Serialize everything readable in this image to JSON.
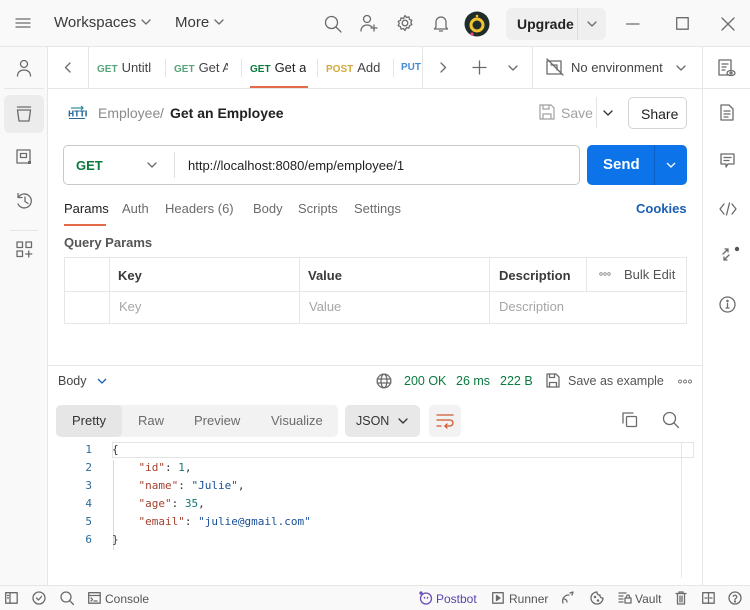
{
  "titlebar": {
    "workspaces_label": "Workspaces",
    "more_label": "More",
    "upgrade_label": "Upgrade",
    "avatar_colors": {
      "bg": "#1f2d2a",
      "ring": "#f2c230",
      "dot": "#e0457b"
    }
  },
  "tabs": [
    {
      "method": "GET",
      "title": "Untitle",
      "method_color": "#58a57a",
      "active": false
    },
    {
      "method": "GET",
      "title": "Get A",
      "method_color": "#58a57a",
      "active": false
    },
    {
      "method": "GET",
      "title": "Get ar",
      "method_color": "#0b7a3e",
      "active": true
    },
    {
      "method": "POST",
      "title": "Add",
      "method_color": "#d4a93a",
      "active": false
    },
    {
      "method": "PUT",
      "title": "",
      "method_color": "#4a8ad4",
      "active": false
    }
  ],
  "environment": {
    "label": "No environment"
  },
  "breadcrumb": {
    "collection": "Employee",
    "separator": "/",
    "request": "Get an Employee"
  },
  "actions": {
    "save_label": "Save",
    "share_label": "Share"
  },
  "request": {
    "method": "GET",
    "url": "http://localhost:8080/emp/employee/1",
    "send_label": "Send"
  },
  "request_tabs": [
    {
      "label": "Params",
      "active": true
    },
    {
      "label": "Auth",
      "active": false
    },
    {
      "label": "Headers (6)",
      "active": false
    },
    {
      "label": "Body",
      "active": false
    },
    {
      "label": "Scripts",
      "active": false
    },
    {
      "label": "Settings",
      "active": false
    }
  ],
  "cookies_label": "Cookies",
  "query_params": {
    "title": "Query Params",
    "columns": [
      "Key",
      "Value",
      "Description"
    ],
    "bulk_edit_label": "Bulk Edit",
    "placeholders": {
      "key": "Key",
      "value": "Value",
      "description": "Description"
    }
  },
  "response": {
    "body_label": "Body",
    "status": "200 OK",
    "time": "26 ms",
    "size": "222 B",
    "save_example_label": "Save as example",
    "view_tabs": [
      "Pretty",
      "Raw",
      "Preview",
      "Visualize"
    ],
    "active_view": "Pretty",
    "format": "JSON",
    "line_numbers": [
      "1",
      "2",
      "3",
      "4",
      "5",
      "6"
    ],
    "body_lines": [
      {
        "indent": "",
        "key": "",
        "value": "",
        "text": "{"
      },
      {
        "indent": "    ",
        "key": "\"id\"",
        "value": "1",
        "type": "n",
        "trail": ","
      },
      {
        "indent": "    ",
        "key": "\"name\"",
        "value": "\"Julie\"",
        "type": "s",
        "trail": ","
      },
      {
        "indent": "    ",
        "key": "\"age\"",
        "value": "35",
        "type": "n",
        "trail": ","
      },
      {
        "indent": "    ",
        "key": "\"email\"",
        "value": "\"julie@gmail.com\"",
        "type": "s",
        "trail": ""
      },
      {
        "indent": "",
        "key": "",
        "value": "",
        "text": "}"
      }
    ]
  },
  "footer": {
    "console_label": "Console",
    "postbot_label": "Postbot",
    "runner_label": "Runner",
    "vault_label": "Vault"
  },
  "colors": {
    "accent": "#0c73e8",
    "tab_underline": "#e36b4a",
    "status_ok": "#0b7a3e",
    "postbot": "#6b4fbb"
  }
}
